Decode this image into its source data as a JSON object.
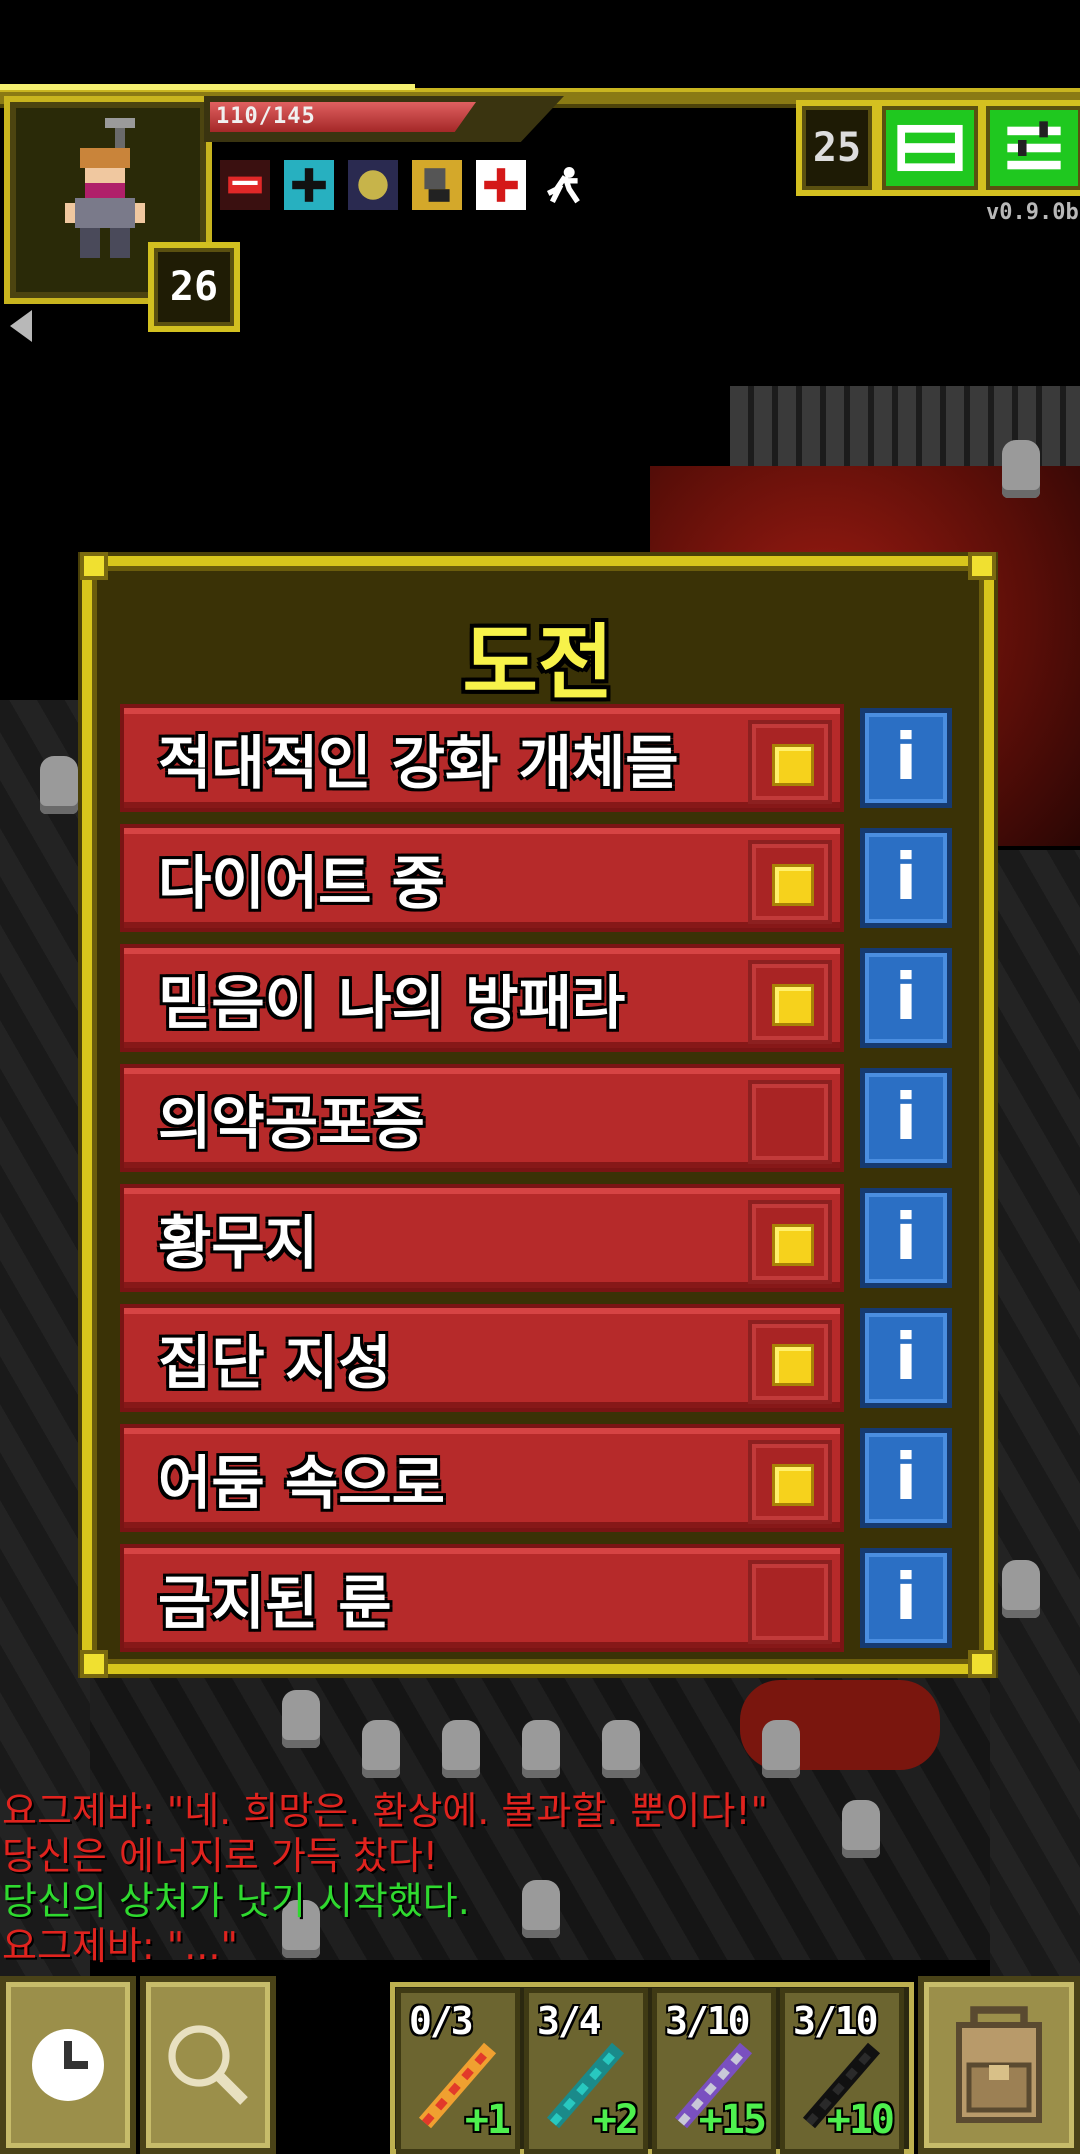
{
  "hud": {
    "hp_text": "110/145",
    "hp_fraction": 0.76,
    "level": "26",
    "depth": "25",
    "version": "v0.9.0b",
    "buffs": [
      "bleeding-icon",
      "shield-plus-icon",
      "light-icon",
      "terror-icon",
      "healing-icon",
      "haste-icon"
    ]
  },
  "challenges": {
    "title": "도전",
    "items": [
      {
        "label": "적대적인 강화 개체들",
        "checked": true
      },
      {
        "label": "다이어트 중",
        "checked": true
      },
      {
        "label": "믿음이 나의 방패라",
        "checked": true
      },
      {
        "label": "의약공포증",
        "checked": false
      },
      {
        "label": "황무지",
        "checked": true
      },
      {
        "label": "집단 지성",
        "checked": true
      },
      {
        "label": "어둠 속으로",
        "checked": true
      },
      {
        "label": "금지된 룬",
        "checked": false
      }
    ],
    "info_label": "i"
  },
  "log": [
    {
      "text": "요그제바: \"네. 희망은. 환상에. 불과할. 뿐이다!\"",
      "color": "#e0231e"
    },
    {
      "text": "당신은 에너지로 가득 찼다!",
      "color": "#e0231e"
    },
    {
      "text": "당신의 상처가 낫기 시작했다.",
      "color": "#2fd92f"
    },
    {
      "text": "요그제바: \"...\"",
      "color": "#e0231e"
    }
  ],
  "quickslots": [
    {
      "count": "0/3",
      "bonus": "+1",
      "icon": "fire-wand-icon"
    },
    {
      "count": "3/4",
      "bonus": "+2",
      "icon": "frost-wand-icon"
    },
    {
      "count": "3/10",
      "bonus": "+15",
      "icon": "magic-missile-wand-icon"
    },
    {
      "count": "3/10",
      "bonus": "+10",
      "icon": "shadow-wand-icon"
    }
  ]
}
